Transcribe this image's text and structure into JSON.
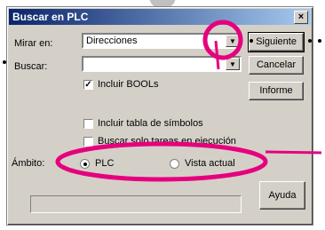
{
  "window": {
    "title": "Buscar en PLC",
    "close_glyph": "×"
  },
  "form": {
    "mirar_label": "Mirar en:",
    "mirar_value": "Direcciones",
    "buscar_label": "Buscar:",
    "buscar_value": "",
    "incluir_bools_label": "Incluir BOOLs",
    "incluir_bools_checked": true,
    "incluir_tabla_label": "Incluir tabla de símbolos",
    "incluir_tabla_checked": false,
    "buscar_tareas_label": "Buscar solo tareas en ejecución",
    "buscar_tareas_checked": false,
    "ambito_label": "Ámbito:",
    "radio_plc_label": "PLC",
    "radio_vista_label": "Vista actual",
    "selected_scope": "PLC"
  },
  "buttons": {
    "siguiente": "Siguiente",
    "cancelar": "Cancelar",
    "informe": "Informe",
    "ayuda": "Ayuda"
  },
  "annotation_color": "#e6007e"
}
